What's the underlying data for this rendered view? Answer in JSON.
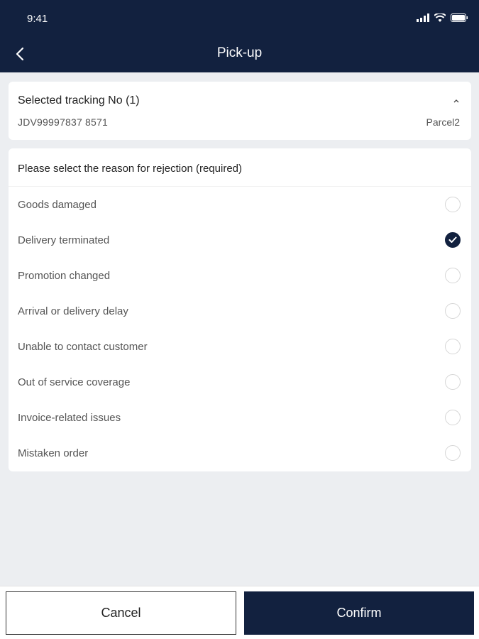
{
  "status_bar": {
    "time": "9:41"
  },
  "header": {
    "title": "Pick-up"
  },
  "tracking": {
    "label": "Selected tracking No (1)",
    "number": "JDV99997837 8571",
    "parcel": "Parcel2"
  },
  "reasons": {
    "heading": "Please select the reason for rejection (required)",
    "items": [
      {
        "label": "Goods damaged",
        "selected": false
      },
      {
        "label": "Delivery terminated",
        "selected": true
      },
      {
        "label": "Promotion changed",
        "selected": false
      },
      {
        "label": "Arrival or delivery delay",
        "selected": false
      },
      {
        "label": "Unable to contact customer",
        "selected": false
      },
      {
        "label": "Out of service coverage",
        "selected": false
      },
      {
        "label": "Invoice-related issues",
        "selected": false
      },
      {
        "label": "Mistaken order",
        "selected": false
      }
    ]
  },
  "footer": {
    "cancel_label": "Cancel",
    "confirm_label": "Confirm"
  },
  "colors": {
    "primary": "#12213f",
    "background": "#eceef1"
  }
}
